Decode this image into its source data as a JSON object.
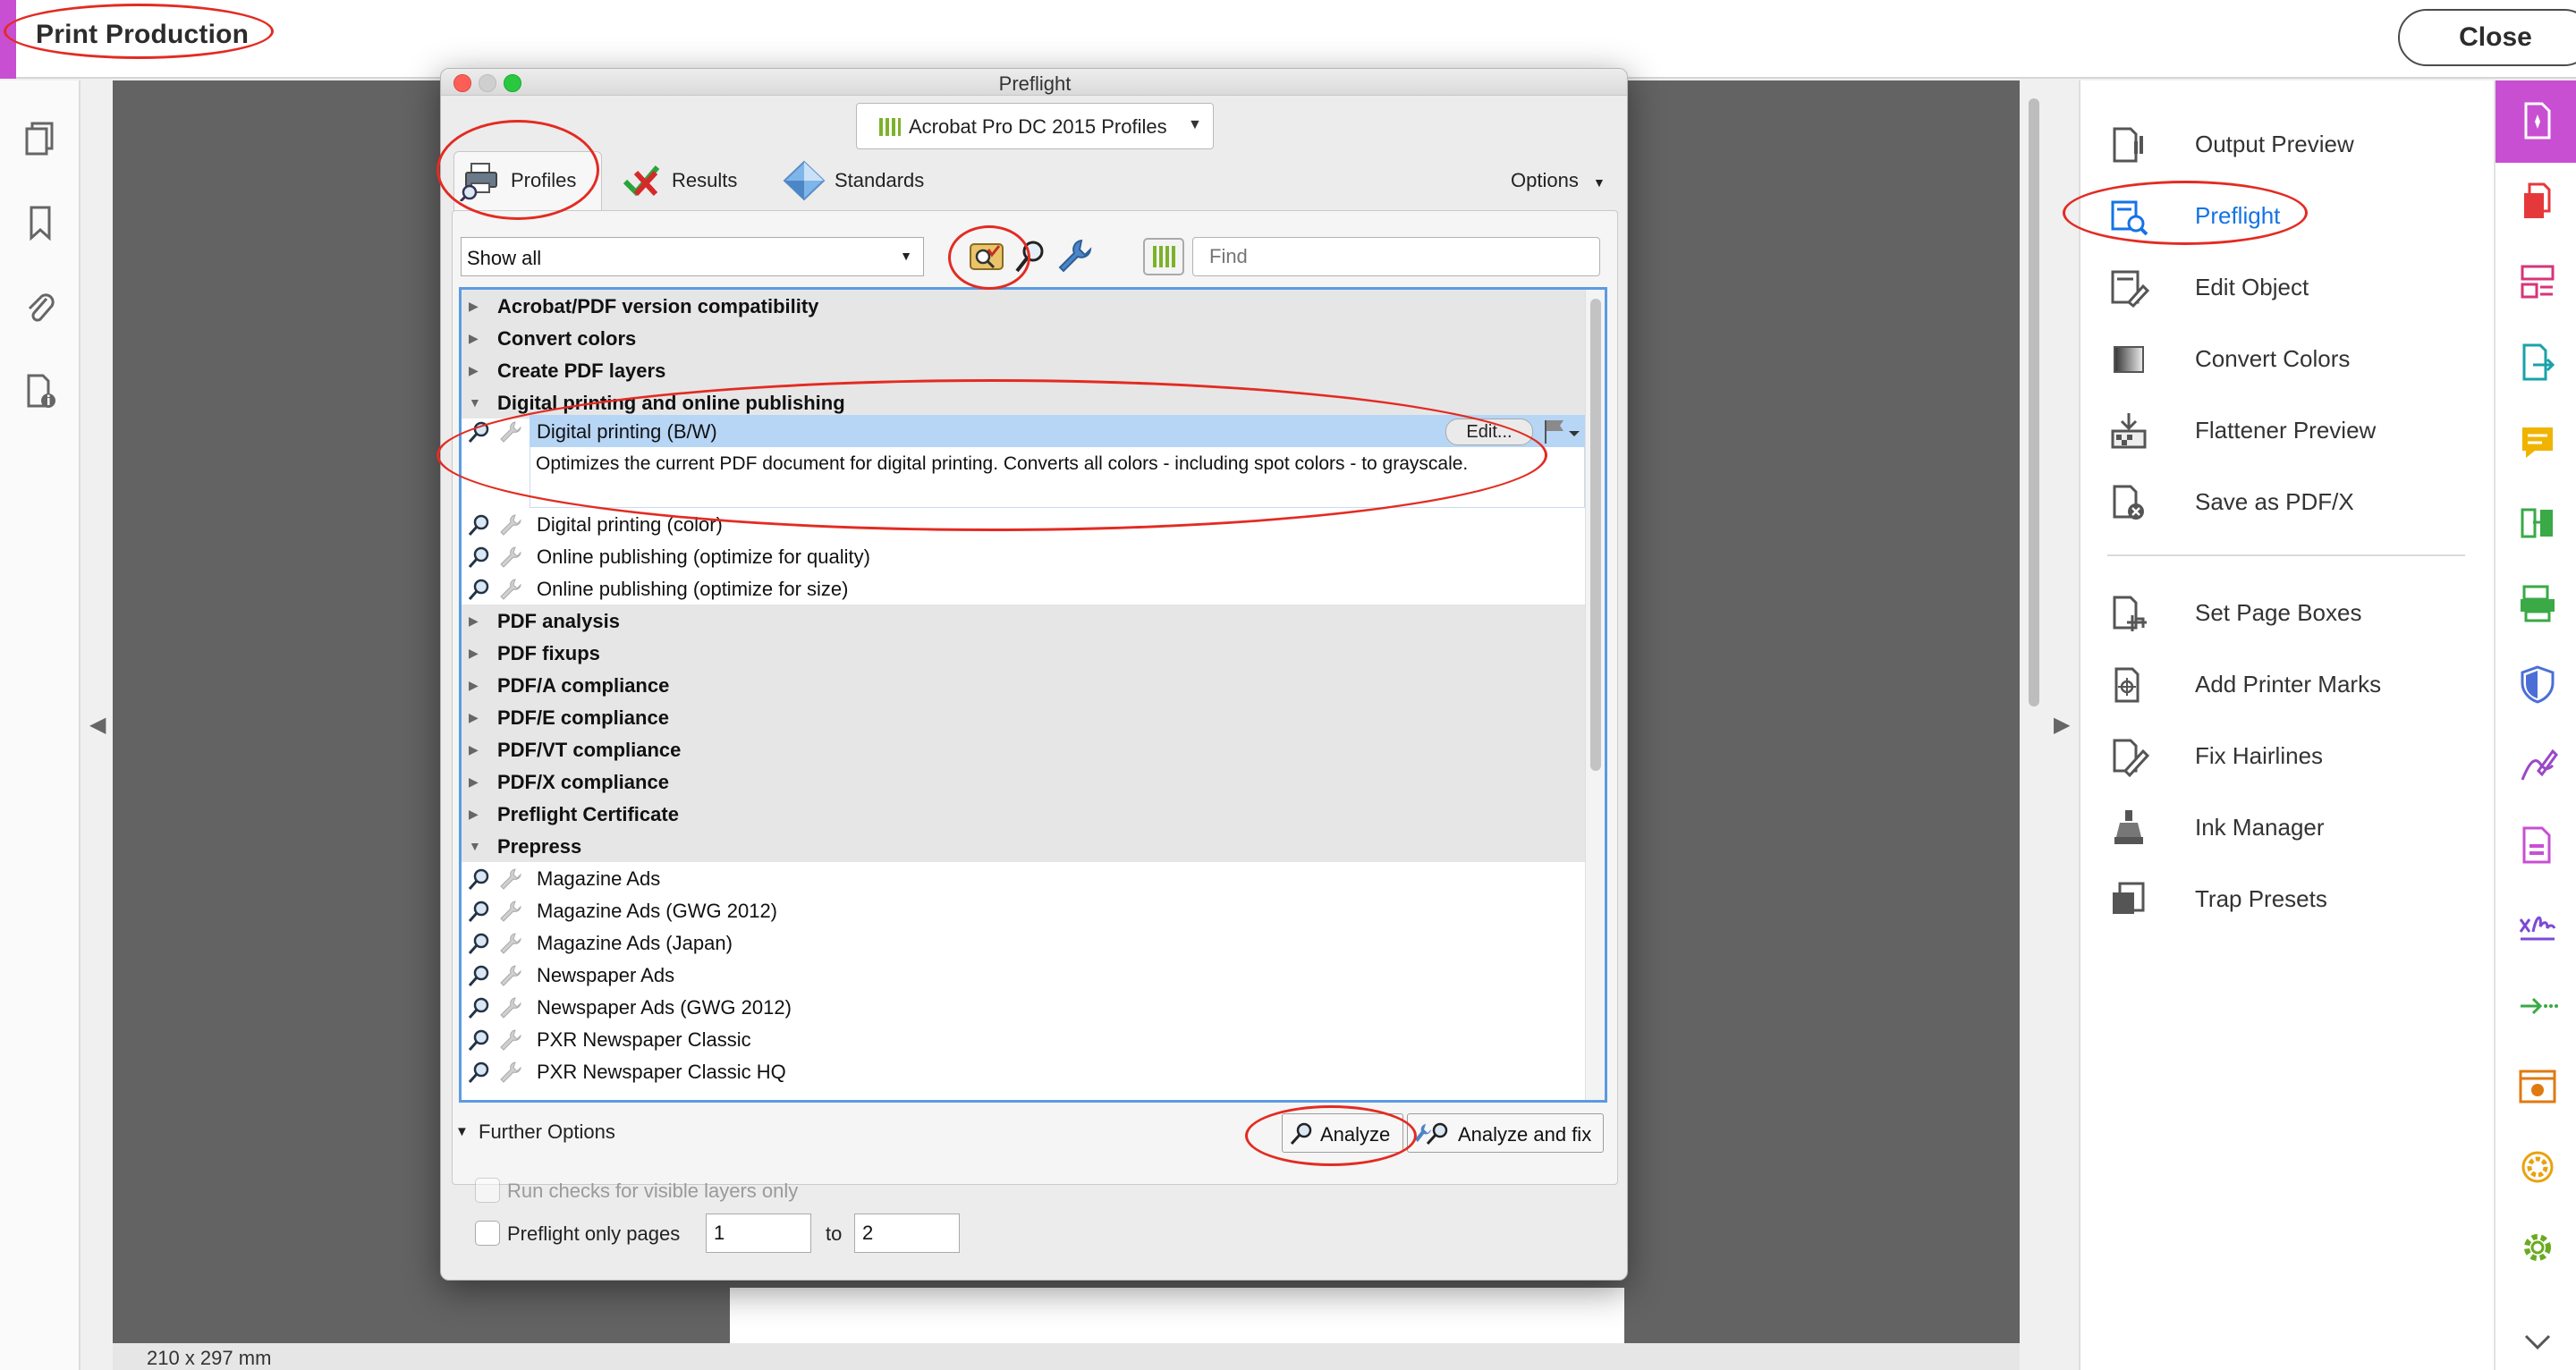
{
  "app": {
    "title": "Print Production",
    "close_label": "Close"
  },
  "left_rail": {
    "icons": [
      "pages-icon",
      "bookmark-icon",
      "attachment-icon",
      "document-info-icon"
    ]
  },
  "status": {
    "page_size": "210 x 297 mm"
  },
  "tools": {
    "items": [
      {
        "label": "Output Preview",
        "icon": "output-preview-icon",
        "active": false
      },
      {
        "label": "Preflight",
        "icon": "preflight-icon",
        "active": true
      },
      {
        "label": "Edit Object",
        "icon": "edit-object-icon",
        "active": false
      },
      {
        "label": "Convert Colors",
        "icon": "convert-colors-icon",
        "active": false
      },
      {
        "label": "Flattener Preview",
        "icon": "flattener-preview-icon",
        "active": false
      },
      {
        "label": "Save as PDF/X",
        "icon": "save-pdfx-icon",
        "active": false
      },
      {
        "label": "Set Page Boxes",
        "icon": "set-page-boxes-icon",
        "active": false
      },
      {
        "label": "Add Printer Marks",
        "icon": "printer-marks-icon",
        "active": false
      },
      {
        "label": "Fix Hairlines",
        "icon": "fix-hairlines-icon",
        "active": false
      },
      {
        "label": "Ink Manager",
        "icon": "ink-manager-icon",
        "active": false
      },
      {
        "label": "Trap Presets",
        "icon": "trap-presets-icon",
        "active": false
      }
    ]
  },
  "dialog": {
    "title": "Preflight",
    "profile_set": "Acrobat Pro DC 2015 Profiles",
    "tabs": {
      "profiles": "Profiles",
      "results": "Results",
      "standards": "Standards"
    },
    "options_label": "Options",
    "filter_value": "Show all",
    "find_placeholder": "Find",
    "groups": {
      "g0": "Acrobat/PDF version compatibility",
      "g1": "Convert colors",
      "g2": "Create PDF layers",
      "g3": "Digital printing and online publishing",
      "g4": "PDF analysis",
      "g5": "PDF fixups",
      "g6": "PDF/A compliance",
      "g7": "PDF/E compliance",
      "g8": "PDF/VT compliance",
      "g9": "PDF/X compliance",
      "g10": "Preflight Certificate",
      "g11": "Prepress"
    },
    "selected_profile": {
      "name": "Digital printing (B/W)",
      "description": "Optimizes the current PDF document for digital printing. Converts all colors - including spot colors - to grayscale.",
      "edit_label": "Edit..."
    },
    "digital_items": {
      "i0": "Digital printing (color)",
      "i1": "Online publishing (optimize for quality)",
      "i2": "Online publishing (optimize for size)"
    },
    "prepress_items": {
      "i0": "Magazine Ads",
      "i1": "Magazine Ads (GWG 2012)",
      "i2": "Magazine Ads (Japan)",
      "i3": "Newspaper Ads",
      "i4": "Newspaper Ads (GWG 2012)",
      "i5": "PXR Newspaper Classic",
      "i6": "PXR Newspaper Classic HQ"
    },
    "further_options_label": "Further Options",
    "analyze_label": "Analyze",
    "analyze_fix_label": "Analyze and fix",
    "visible_layers_label": "Run checks for visible layers only",
    "pages_only_label": "Preflight only pages",
    "page_from": "1",
    "to_label": "to",
    "page_to": "2"
  },
  "colors": {
    "accent": "#c84fd2",
    "selection": "#b7d5f5",
    "annotation": "#e32b22",
    "link": "#1473e6"
  }
}
